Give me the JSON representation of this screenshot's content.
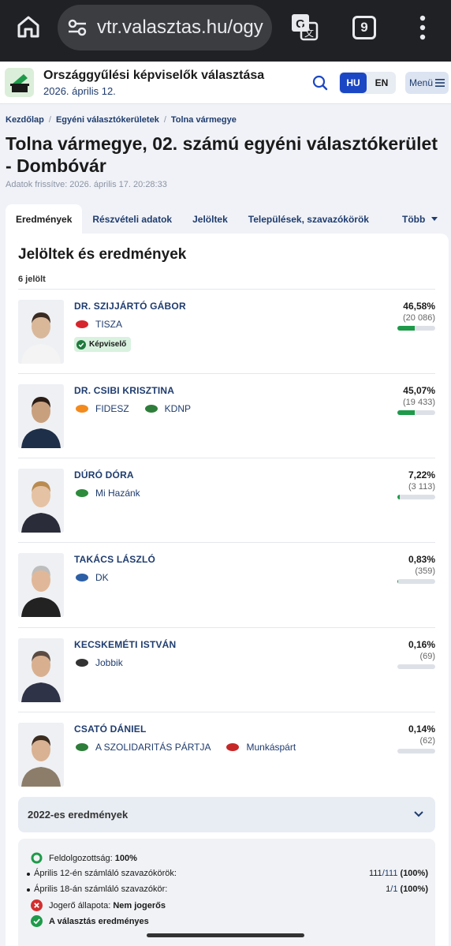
{
  "browser": {
    "url": "vtr.valasztas.hu/ogy",
    "tab_count": "9"
  },
  "header": {
    "title": "Országgyűlési képviselők választása",
    "date": "2026. április 12.",
    "lang_hu": "HU",
    "lang_en": "EN",
    "menu_label": "Menü"
  },
  "breadcrumb": [
    "Kezdőlap",
    "Egyéni választókerületek",
    "Tolna vármegye"
  ],
  "page": {
    "title": "Tolna vármegye, 02. számú egyéni választókerület - Dombóvár",
    "updated": "Adatok frissítve: 2026. április 17. 20:28:33"
  },
  "tabs": [
    "Eredmények",
    "Részvételi adatok",
    "Jelöltek",
    "Települések, szavazókörök",
    "Több"
  ],
  "results": {
    "heading": "Jelöltek és eredmények",
    "count": "6 jelölt",
    "candidates": [
      {
        "name": "DR. SZIJJÁRTÓ GÁBOR",
        "parties": [
          {
            "name": "TISZA",
            "logo": "tisza-logo",
            "color": "#d6252d"
          }
        ],
        "badge": "Képviselő",
        "percent": "46,58%",
        "votes": "(20 086)",
        "share": 0.4658
      },
      {
        "name": "DR. CSIBI KRISZTINA",
        "parties": [
          {
            "name": "FIDESZ",
            "logo": "fidesz-logo",
            "color": "#f28a1e"
          },
          {
            "name": "KDNP",
            "logo": "kdnp-logo",
            "color": "#2e7d3a"
          }
        ],
        "badge": "",
        "percent": "45,07%",
        "votes": "(19 433)",
        "share": 0.4507
      },
      {
        "name": "DÚRÓ DÓRA",
        "parties": [
          {
            "name": "Mi Hazánk",
            "logo": "mi-hazank-logo",
            "color": "#2e8b3d"
          }
        ],
        "badge": "",
        "percent": "7,22%",
        "votes": "(3 113)",
        "share": 0.0722
      },
      {
        "name": "TAKÁCS LÁSZLÓ",
        "parties": [
          {
            "name": "DK",
            "logo": "dk-logo",
            "color": "#2d5fa6"
          }
        ],
        "badge": "",
        "percent": "0,83%",
        "votes": "(359)",
        "share": 0.0083
      },
      {
        "name": "KECSKEMÉTI ISTVÁN",
        "parties": [
          {
            "name": "Jobbik",
            "logo": "jobbik-logo",
            "color": "#333333"
          }
        ],
        "badge": "",
        "percent": "0,16%",
        "votes": "(69)",
        "share": 0.0016
      },
      {
        "name": "CSATÓ DÁNIEL",
        "parties": [
          {
            "name": "A SZOLIDARITÁS PÁRTJA",
            "logo": "szolidaritas-logo",
            "color": "#2e7d3a"
          },
          {
            "name": "Munkáspárt",
            "logo": "munkaspart-logo",
            "color": "#c62828"
          }
        ],
        "badge": "",
        "percent": "0,14%",
        "votes": "(62)",
        "share": 0.0014
      }
    ]
  },
  "previous": {
    "label": "2022-es eredmények"
  },
  "stats": {
    "processed_label": "Feldolgozottság:",
    "processed_value": "100%",
    "rows": [
      {
        "label": "Április 12-én számláló szavazókörök:",
        "count": "111",
        "total": "/111",
        "pct": "(100%)"
      },
      {
        "label": "Április 18-án számláló szavazókör:",
        "count": "1",
        "total": "/1",
        "pct": "(100%)"
      }
    ],
    "legal_label": "Jogerő állapota:",
    "legal_value": "Nem jogerős",
    "valid_label": "A választás eredményes"
  }
}
